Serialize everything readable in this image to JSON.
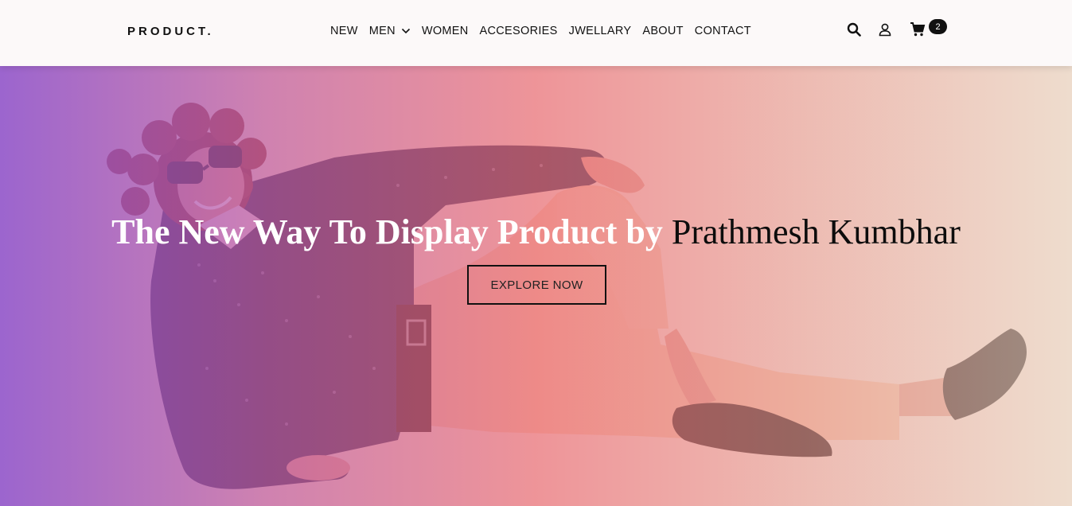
{
  "header": {
    "logo": "PRODUCT.",
    "nav": [
      {
        "label": "NEW"
      },
      {
        "label": "MEN",
        "has_dropdown": true
      },
      {
        "label": "WOMEN"
      },
      {
        "label": "ACCESORIES"
      },
      {
        "label": "JWELLARY"
      },
      {
        "label": "ABOUT"
      },
      {
        "label": "CONTACT"
      }
    ],
    "icons": [
      "search-icon",
      "user-icon",
      "cart-icon"
    ],
    "cart_count": "2"
  },
  "hero": {
    "headline_main": "The New Way To Display Product by ",
    "headline_name": "Prathmesh Kumbhar",
    "cta_label": "EXPLORE NOW"
  },
  "colors": {
    "gradient_left": "#8e50cd",
    "gradient_mid": "#f06e78",
    "gradient_right": "#f0dcc8",
    "header_bg": "#fcf9f9",
    "text_dark": "#111111"
  }
}
